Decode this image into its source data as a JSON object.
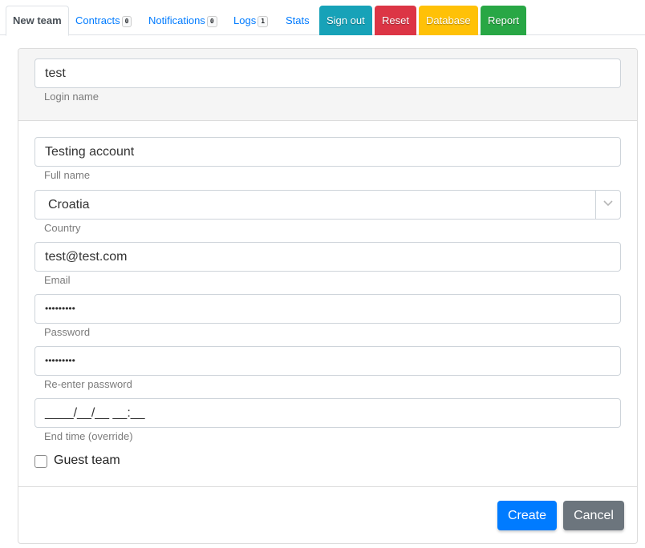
{
  "tabs": {
    "items": [
      {
        "label": "New team",
        "active": true
      },
      {
        "label": "Contracts",
        "badge": "0"
      },
      {
        "label": "Notifications",
        "badge": "0"
      },
      {
        "label": "Logs",
        "badge": "1"
      },
      {
        "label": "Stats"
      }
    ],
    "buttons": [
      {
        "label": "Sign out",
        "color": "#17a2b8"
      },
      {
        "label": "Reset",
        "color": "#dc3545"
      },
      {
        "label": "Database",
        "color": "#ffc107"
      },
      {
        "label": "Report",
        "color": "#28a745"
      }
    ]
  },
  "form": {
    "login_name": {
      "value": "test",
      "label": "Login name"
    },
    "full_name": {
      "value": "Testing account",
      "label": "Full name"
    },
    "country": {
      "value": "Croatia",
      "label": "Country"
    },
    "email": {
      "value": "test@test.com",
      "label": "Email"
    },
    "password": {
      "value": "•••••••••",
      "label": "Password"
    },
    "password_confirm": {
      "value": "•••••••••",
      "label": "Re-enter password"
    },
    "end_time": {
      "value": "____/__/__ __:__",
      "label": "End time (override)"
    },
    "guest_team": {
      "label": "Guest team",
      "checked": false
    }
  },
  "footer": {
    "create_label": "Create",
    "cancel_label": "Cancel",
    "create_color": "#007bff",
    "cancel_color": "#6c757d"
  }
}
